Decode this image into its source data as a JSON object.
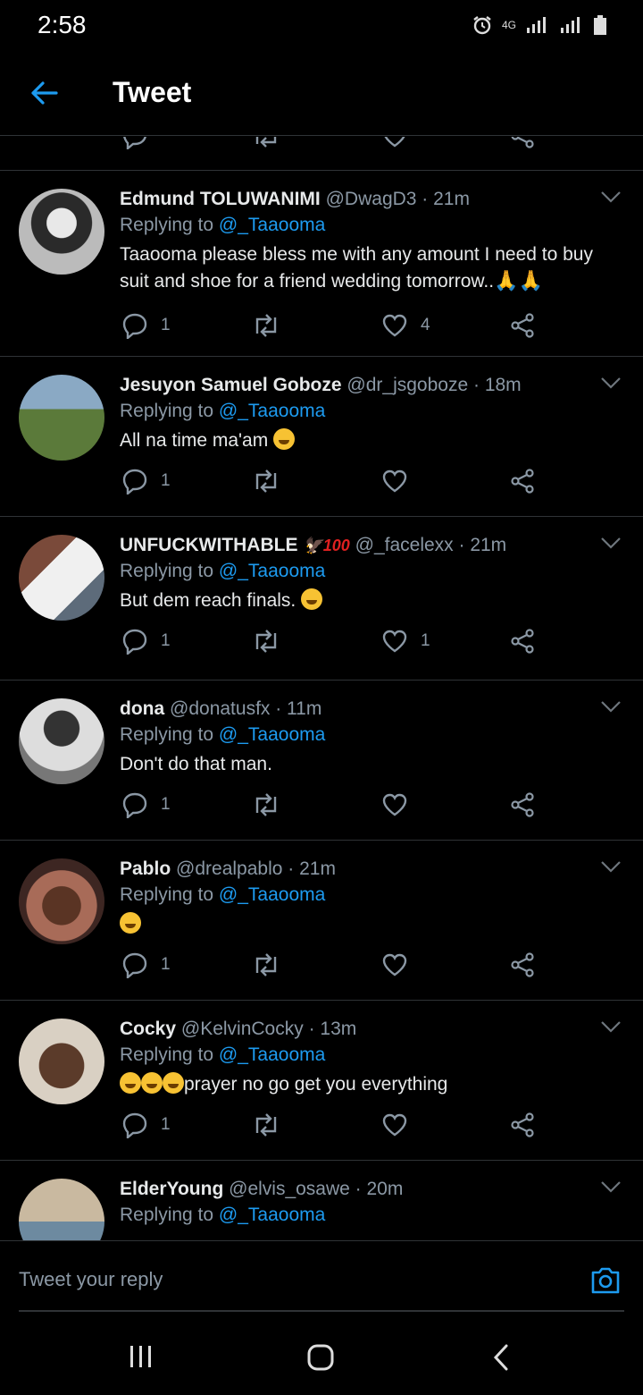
{
  "status": {
    "time": "2:58",
    "network": "4G"
  },
  "header": {
    "title": "Tweet"
  },
  "replies": [
    {
      "name": "Edmund TOLUWANIMI",
      "handle": "@DwagD3 · 21m",
      "replying_to": "Replying to ",
      "mention": "@_Taaooma",
      "text": "Taaooma please bless me with any amount I need to buy suit and shoe for a friend wedding tomorrow..",
      "reply_count": "1",
      "like_count": "4"
    },
    {
      "name": "Jesuyon Samuel Goboze",
      "handle": "@dr_jsgoboze · 18m",
      "replying_to": "Replying to ",
      "mention": "@_Taaooma",
      "text": "All na time ma'am",
      "reply_count": "1",
      "like_count": ""
    },
    {
      "name": "UNFUCKWITHABLE",
      "handle": "@_facelexx · 21m",
      "replying_to": "Replying to ",
      "mention": "@_Taaooma",
      "text": "But dem reach finals.",
      "reply_count": "1",
      "like_count": "1"
    },
    {
      "name": "dona",
      "handle": "@donatusfx · 11m",
      "replying_to": "Replying to ",
      "mention": "@_Taaooma",
      "text": "Don't do that man.",
      "reply_count": "1",
      "like_count": ""
    },
    {
      "name": "Pablo",
      "handle": "@drealpablo · 21m",
      "replying_to": "Replying to ",
      "mention": "@_Taaooma",
      "text": "",
      "reply_count": "1",
      "like_count": ""
    },
    {
      "name": "Cocky",
      "handle": "@KelvinCocky · 13m",
      "replying_to": "Replying to ",
      "mention": "@_Taaooma",
      "text": "prayer no go get you everything",
      "reply_count": "1",
      "like_count": ""
    },
    {
      "name": "ElderYoung",
      "handle": "@elvis_osawe · 20m",
      "replying_to": "Replying to ",
      "mention": "@_Taaooma",
      "text": "",
      "reply_count": "",
      "like_count": ""
    }
  ],
  "composer": {
    "placeholder": "Tweet your reply"
  },
  "colors": {
    "accent": "#1d9bf0",
    "muted": "#8b98a5",
    "divider": "#2f3336",
    "background": "#000000"
  }
}
